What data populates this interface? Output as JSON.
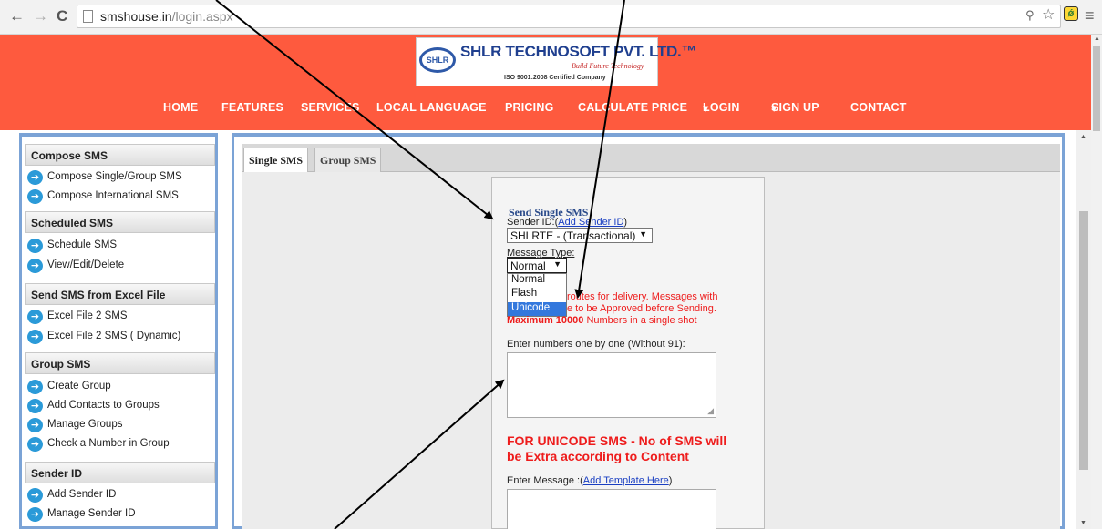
{
  "browser": {
    "back_glyph": "←",
    "forward_glyph": "→",
    "reload_glyph": "C",
    "url_host": "smshouse.in",
    "url_path": "/login.aspx",
    "star_glyph": "☆",
    "menu_glyph": "≡",
    "ext_glyph": "ǿ"
  },
  "site": {
    "logo_badge": "SHLR",
    "company_name": "SHLR TECHNOSOFT PVT. LTD.™",
    "tagline": "Build Future Technology",
    "iso": "ISO 9001:2008 Certified Company",
    "menu": [
      "HOME",
      "FEATURES",
      "SERVICES",
      "LOCAL LANGUAGE",
      "PRICING",
      "CALCULATE PRICE",
      "LOGIN",
      "SIGN UP",
      "CONTACT"
    ],
    "menu_caret": "▾"
  },
  "sidebar": {
    "arrow_glyph": "➔",
    "sections": [
      {
        "title": "Compose SMS",
        "items": [
          "Compose Single/Group SMS",
          "Compose International SMS"
        ]
      },
      {
        "title": "Scheduled SMS",
        "items": [
          "Schedule SMS",
          "View/Edit/Delete"
        ]
      },
      {
        "title": "Send SMS from Excel File",
        "items": [
          "Excel File 2 SMS",
          "Excel File 2 SMS ( Dynamic)"
        ]
      },
      {
        "title": "Group SMS",
        "items": [
          "Create Group",
          "Add Contacts to Groups",
          "Manage Groups",
          "Check a Number in Group"
        ]
      },
      {
        "title": "Sender ID",
        "items": [
          "Add Sender ID",
          "Manage Sender ID"
        ]
      }
    ]
  },
  "tabs": [
    {
      "label": "Single SMS",
      "active": true
    },
    {
      "label": "Group SMS",
      "active": false
    }
  ],
  "form": {
    "title": "Send Single SMS",
    "sender_label": "Sender ID:(",
    "sender_link": "Add Sender ID",
    "sender_close": ")",
    "sender_value": "SHLRTE - (Transactional)",
    "message_type_label": "Message Type:",
    "message_type_value": "Normal",
    "message_type_options": [
      "Normal",
      "Flash",
      "Unicode"
    ],
    "message_type_highlighted": "Unicode",
    "notice_line1": "routes for delivery. Messages with",
    "notice_line2": "e to be Approved before Sending.",
    "max_bold": "Maximum 10000",
    "max_rest": " Numbers in a single shot",
    "numbers_label": "Enter numbers one by one (Without 91):",
    "numbers_value": "",
    "unicode_warning_line1": "FOR UNICODE SMS - No of SMS will",
    "unicode_warning_line2": "be Extra according to Content",
    "message_label": "Enter Message :(",
    "message_link": "Add Template Here",
    "message_close": ")",
    "message_value": ""
  },
  "colors": {
    "header_bg": "#fe5a3e",
    "panel_border": "#7ba3d6",
    "highlight": "#3378dd",
    "warning_red": "#ee1c1c"
  }
}
